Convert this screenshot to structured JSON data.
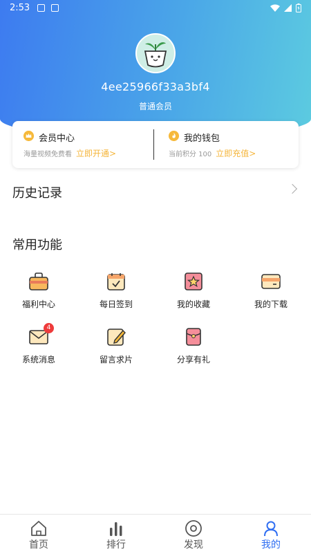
{
  "status_bar": {
    "time": "2:53"
  },
  "profile": {
    "username": "4ee25966f33a3bf4",
    "level": "普通会员"
  },
  "member_card": {
    "vip": {
      "title": "会员中心",
      "subtitle": "海量视频免费看",
      "link": "立即开通>"
    },
    "wallet": {
      "title": "我的钱包",
      "subtitle": "当前积分 100",
      "link": "立即充值>"
    }
  },
  "history": {
    "title": "历史记录"
  },
  "common": {
    "title": "常用功能",
    "items": [
      {
        "label": "福利中心",
        "icon": "gift-box-icon"
      },
      {
        "label": "每日签到",
        "icon": "calendar-check-icon"
      },
      {
        "label": "我的收藏",
        "icon": "star-icon"
      },
      {
        "label": "我的下载",
        "icon": "download-card-icon"
      },
      {
        "label": "系统消息",
        "icon": "mail-icon",
        "badge": "4"
      },
      {
        "label": "留言求片",
        "icon": "note-pencil-icon"
      },
      {
        "label": "分享有礼",
        "icon": "red-envelope-icon"
      }
    ]
  },
  "nav": {
    "items": [
      {
        "label": "首页",
        "icon": "home-icon"
      },
      {
        "label": "排行",
        "icon": "bar-chart-icon"
      },
      {
        "label": "发现",
        "icon": "disc-icon"
      },
      {
        "label": "我的",
        "icon": "user-icon",
        "active": true
      }
    ]
  },
  "colors": {
    "accent": "#2f6ef2",
    "link": "#f5b53a",
    "header_start": "#3d7bf0",
    "header_end": "#5ccbe0",
    "badge": "#ee3b3b"
  }
}
